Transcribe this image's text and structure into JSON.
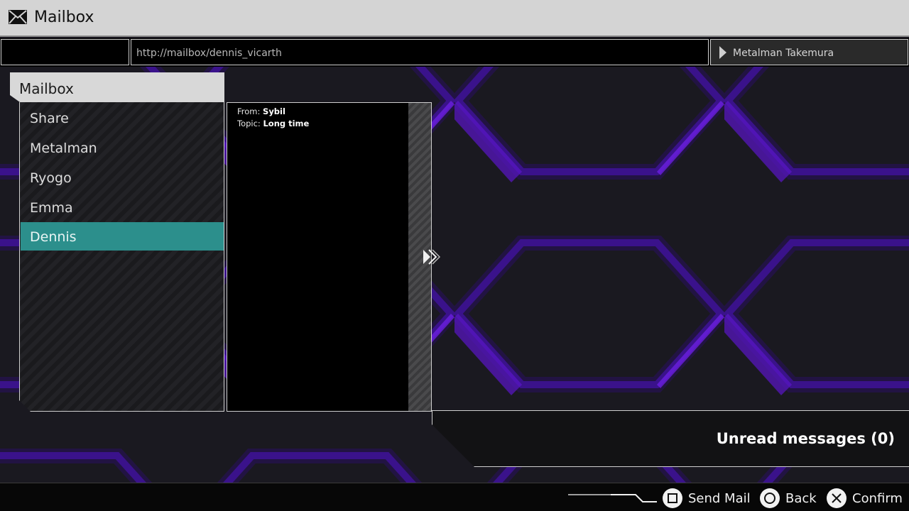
{
  "window": {
    "title": "Mailbox",
    "icon": "envelope-icon"
  },
  "address": {
    "url": "http://mailbox/dennis_vicarth",
    "user": "Metalman Takemura"
  },
  "mailbox": {
    "header": "Mailbox",
    "items": [
      {
        "label": "Share",
        "selected": false
      },
      {
        "label": "Metalman",
        "selected": false
      },
      {
        "label": "Ryogo",
        "selected": false
      },
      {
        "label": "Emma",
        "selected": false
      },
      {
        "label": "Dennis",
        "selected": true
      }
    ]
  },
  "message": {
    "from_label": "From:",
    "from_value": "Sybil",
    "topic_label": "Topic:",
    "topic_value": "Long time"
  },
  "status": {
    "unread": "Unread messages (0)"
  },
  "controls": [
    {
      "glyph": "square-button-icon",
      "label": "Send Mail"
    },
    {
      "glyph": "circle-button-icon",
      "label": "Back"
    },
    {
      "glyph": "cross-button-icon",
      "label": "Confirm"
    }
  ],
  "colors": {
    "selection": "#2c8f8c",
    "background_accent": "#5a16c8",
    "titlebar": "#d4d4d4"
  }
}
